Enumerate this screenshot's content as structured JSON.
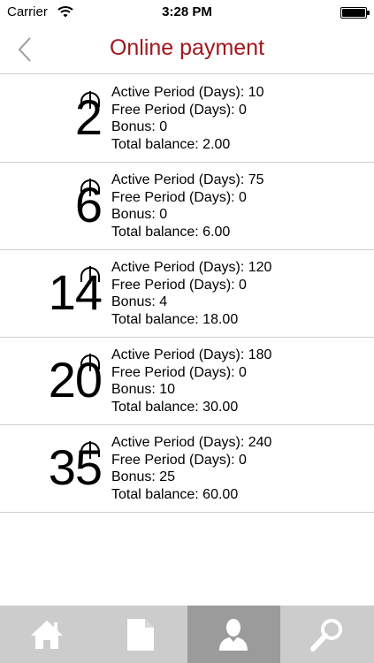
{
  "status_bar": {
    "carrier": "Carrier",
    "time": "3:28 PM"
  },
  "nav": {
    "title": "Online payment"
  },
  "plans": [
    {
      "amount": "2",
      "active_period": "Active Period (Days): 10",
      "free_period": "Free Period (Days): 0",
      "bonus": "Bonus: 0",
      "total_balance": "Total balance: 2.00"
    },
    {
      "amount": "6",
      "active_period": "Active Period (Days): 75",
      "free_period": "Free Period (Days): 0",
      "bonus": "Bonus: 0",
      "total_balance": "Total balance: 6.00"
    },
    {
      "amount": "14",
      "active_period": "Active Period (Days): 120",
      "free_period": "Free Period (Days): 0",
      "bonus": "Bonus: 4",
      "total_balance": "Total balance: 18.00"
    },
    {
      "amount": "20",
      "active_period": "Active Period (Days): 180",
      "free_period": "Free Period (Days): 0",
      "bonus": "Bonus: 10",
      "total_balance": "Total balance: 30.00"
    },
    {
      "amount": "35",
      "active_period": "Active Period (Days): 240",
      "free_period": "Free Period (Days): 0",
      "bonus": "Bonus: 25",
      "total_balance": "Total balance: 60.00"
    }
  ],
  "tabs": [
    {
      "icon": "home-icon",
      "active": false
    },
    {
      "icon": "document-icon",
      "active": false
    },
    {
      "icon": "user-icon",
      "active": true
    },
    {
      "icon": "search-icon",
      "active": false
    }
  ],
  "colors": {
    "title": "#a3161e",
    "tab_bar": "#cccccc",
    "tab_active": "#9b9b9b",
    "tab_icon": "#ffffff",
    "back_chevron": "#9a9a9a"
  }
}
